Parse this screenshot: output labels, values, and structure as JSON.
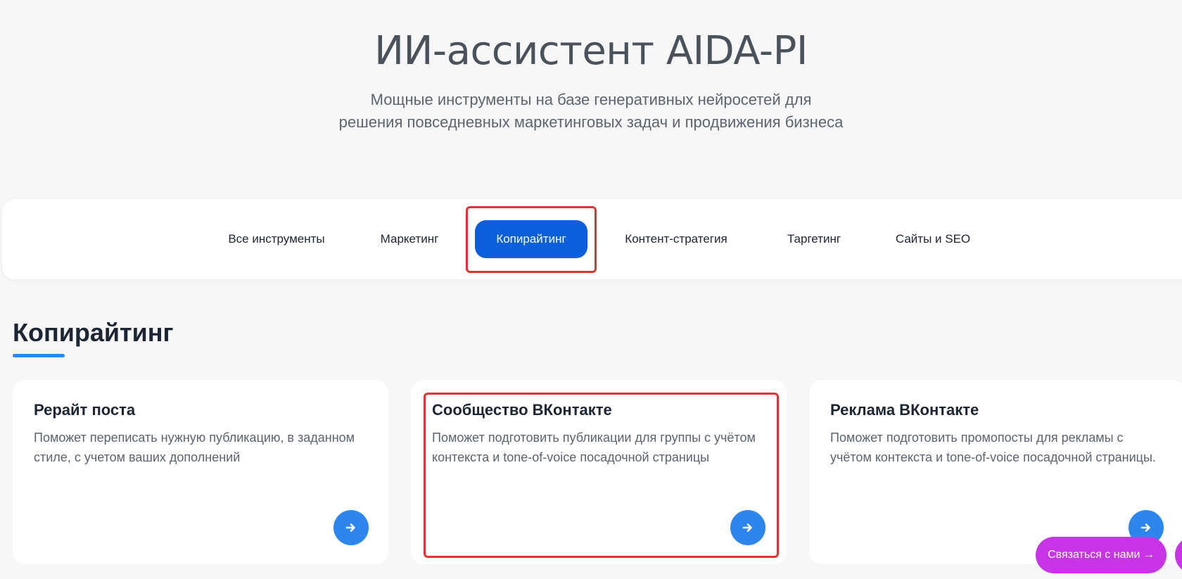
{
  "hero": {
    "title": "ИИ-ассистент AIDA-PI",
    "subtitle_line1": "Мощные инструменты на базе генеративных нейросетей для",
    "subtitle_line2": "решения повседневных маркетинговых задач и продвижения бизнеса"
  },
  "tabs": [
    {
      "label": "Все инструменты",
      "active": false
    },
    {
      "label": "Маркетинг",
      "active": false
    },
    {
      "label": "Копирайтинг",
      "active": true
    },
    {
      "label": "Контент-стратегия",
      "active": false
    },
    {
      "label": "Таргетинг",
      "active": false
    },
    {
      "label": "Сайты и SEO",
      "active": false
    }
  ],
  "section": {
    "title": "Копирайтинг"
  },
  "cards": [
    {
      "title": "Рерайт поста",
      "description": "Поможет переписать нужную публикацию, в заданном стиле, с учетом ваших дополнений",
      "icon": "arrow-right-icon"
    },
    {
      "title": "Сообщество ВКонтакте",
      "description": "Поможет подготовить публикации для группы с учётом контекста и tone-of-voice посадочной страницы",
      "icon": "arrow-right-icon"
    },
    {
      "title": "Реклама ВКонтакте",
      "description": "Поможет подготовить промопосты для рекламы с учётом контекста и tone-of-voice посадочной страницы.",
      "icon": "arrow-right-icon"
    }
  ],
  "contact": {
    "label": "Связаться с нами →"
  },
  "colors": {
    "accent": "#2d86ee",
    "active_tab": "#0b5fdc",
    "highlight": "#e0342f",
    "contact_button": "#c735e6",
    "background": "#f7f7f8"
  }
}
